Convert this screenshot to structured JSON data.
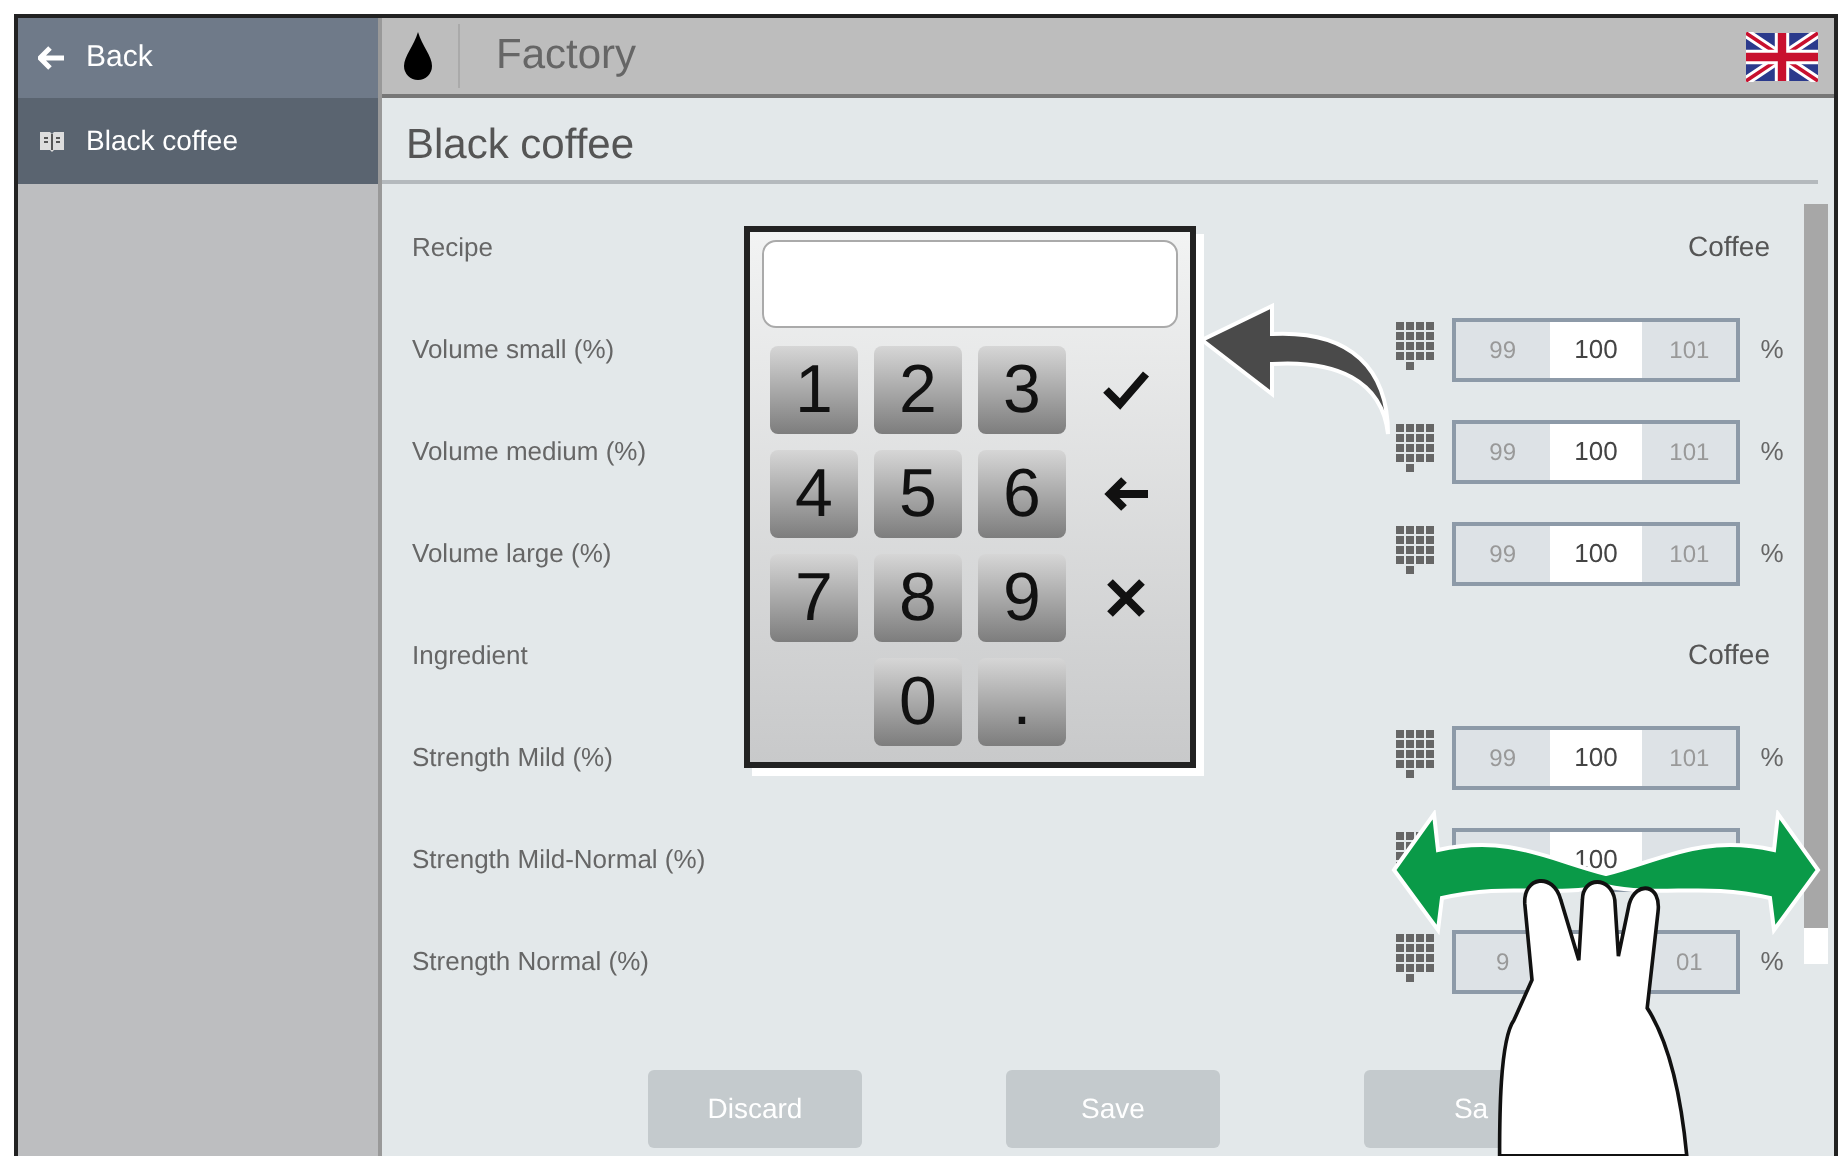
{
  "sidebar": {
    "back": "Back",
    "items": [
      {
        "label": "Black coffee",
        "selected": true
      }
    ]
  },
  "topbar": {
    "title": "Factory"
  },
  "page_title": "Black coffee",
  "rows": [
    {
      "kind": "header",
      "label": "Recipe",
      "value": "Coffee"
    },
    {
      "kind": "spinner",
      "label": "Volume small (%)",
      "lower": "99",
      "value": "100",
      "upper": "101",
      "unit": "%"
    },
    {
      "kind": "spinner",
      "label": "Volume medium (%)",
      "lower": "99",
      "value": "100",
      "upper": "101",
      "unit": "%"
    },
    {
      "kind": "spinner",
      "label": "Volume large (%)",
      "lower": "99",
      "value": "100",
      "upper": "101",
      "unit": "%"
    },
    {
      "kind": "header",
      "label": "Ingredient",
      "value": "Coffee"
    },
    {
      "kind": "spinner",
      "label": "Strength Mild (%)",
      "lower": "99",
      "value": "100",
      "upper": "101",
      "unit": "%"
    },
    {
      "kind": "spinner",
      "label": "Strength Mild-Normal (%)",
      "value": "100"
    },
    {
      "kind": "spinner",
      "label": "Strength Normal (%)",
      "lower": "9",
      "upper": "01",
      "unit": "%"
    }
  ],
  "footer": [
    {
      "label": "Discard",
      "disabled": true
    },
    {
      "label": "Save",
      "disabled": true
    },
    {
      "label": "Sa",
      "disabled": true
    }
  ],
  "keypad": {
    "keys": [
      "1",
      "2",
      "3",
      "4",
      "5",
      "6",
      "7",
      "8",
      "9",
      "0",
      "."
    ],
    "actions": [
      {
        "kind": "confirm"
      },
      {
        "kind": "backspace"
      },
      {
        "kind": "cancel"
      }
    ]
  }
}
